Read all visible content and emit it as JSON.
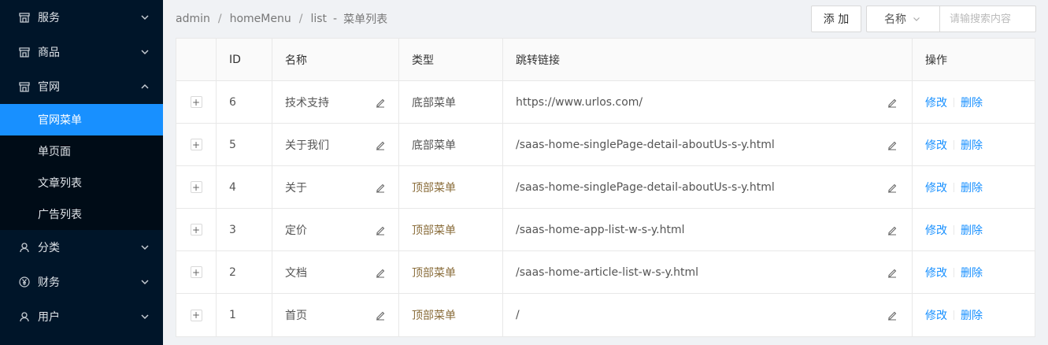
{
  "sidebar": {
    "items": [
      {
        "label": "服务",
        "icon": "shop-icon"
      },
      {
        "label": "商品",
        "icon": "shop-icon"
      },
      {
        "label": "官网",
        "icon": "shop-icon"
      },
      {
        "label": "分类",
        "icon": "user-icon"
      },
      {
        "label": "财务",
        "icon": "yen-icon"
      },
      {
        "label": "用户",
        "icon": "user-icon"
      }
    ],
    "submenu": [
      {
        "label": "官网菜单",
        "active": true
      },
      {
        "label": "单页面"
      },
      {
        "label": "文章列表"
      },
      {
        "label": "广告列表"
      }
    ]
  },
  "breadcrumb": {
    "items": [
      "admin",
      "homeMenu",
      "list"
    ],
    "separator": "/",
    "dash": "-",
    "page_title": "菜单列表"
  },
  "toolbar": {
    "add_label": "添 加",
    "select_value": "名称",
    "search_placeholder": "请输搜索内容"
  },
  "table": {
    "headers": [
      "ID",
      "名称",
      "类型",
      "跳转链接",
      "操作"
    ],
    "rows": [
      {
        "id": "6",
        "name": "技术支持",
        "type": "底部菜单",
        "link": "https://www.urlos.com/"
      },
      {
        "id": "5",
        "name": "关于我们",
        "type": "底部菜单",
        "link": "/saas-home-singlePage-detail-aboutUs-s-y.html"
      },
      {
        "id": "4",
        "name": "关于",
        "type": "顶部菜单",
        "link": "/saas-home-singlePage-detail-aboutUs-s-y.html"
      },
      {
        "id": "3",
        "name": "定价",
        "type": "顶部菜单",
        "link": "/saas-home-app-list-w-s-y.html"
      },
      {
        "id": "2",
        "name": "文档",
        "type": "顶部菜单",
        "link": "/saas-home-article-list-w-s-y.html"
      },
      {
        "id": "1",
        "name": "首页",
        "type": "顶部菜单",
        "link": "/"
      }
    ],
    "expand_symbol": "+",
    "op_edit": "修改",
    "op_delete": "删除"
  },
  "colors": {
    "sidebar_bg": "#001529",
    "submenu_bg": "#000c17",
    "accent": "#1890ff",
    "top_menu_type": "#8a6d3b"
  }
}
